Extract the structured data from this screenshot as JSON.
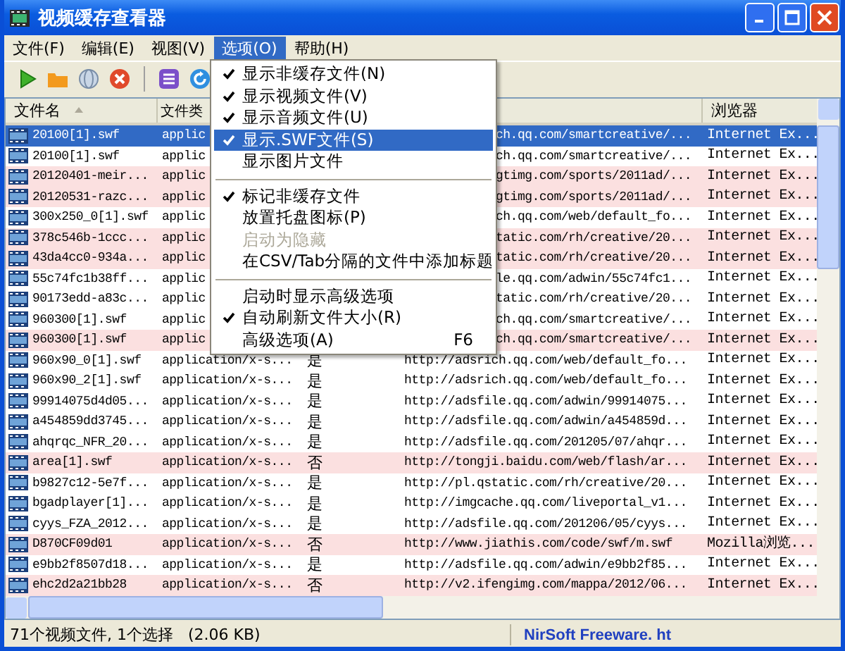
{
  "window": {
    "title": "视频缓存查看器"
  },
  "menu_bar": [
    {
      "label": "文件(F)",
      "selected": false
    },
    {
      "label": "编辑(E)",
      "selected": false
    },
    {
      "label": "视图(V)",
      "selected": false
    },
    {
      "label": "选项(O)",
      "selected": true
    },
    {
      "label": "帮助(H)",
      "selected": false
    }
  ],
  "options_menu": [
    {
      "kind": "item",
      "label": "显示非缓存文件(N)",
      "checked": true,
      "disabled": false,
      "selected": false
    },
    {
      "kind": "item",
      "label": "显示视频文件(V)",
      "checked": true,
      "disabled": false,
      "selected": false
    },
    {
      "kind": "item",
      "label": "显示音频文件(U)",
      "checked": true,
      "disabled": false,
      "selected": false
    },
    {
      "kind": "item",
      "label": "显示.SWF文件(S)",
      "checked": true,
      "disabled": false,
      "selected": true
    },
    {
      "kind": "item",
      "label": "显示图片文件",
      "checked": false,
      "disabled": false,
      "selected": false
    },
    {
      "kind": "separator"
    },
    {
      "kind": "item",
      "label": "标记非缓存文件",
      "checked": true,
      "disabled": false,
      "selected": false
    },
    {
      "kind": "item",
      "label": "放置托盘图标(P)",
      "checked": false,
      "disabled": false,
      "selected": false
    },
    {
      "kind": "item",
      "label": "启动为隐藏",
      "checked": false,
      "disabled": true,
      "selected": false
    },
    {
      "kind": "item",
      "label": "在CSV/Tab分隔的文件中添加标题",
      "checked": false,
      "disabled": false,
      "selected": false
    },
    {
      "kind": "separator"
    },
    {
      "kind": "item",
      "label": "启动时显示高级选项",
      "checked": false,
      "disabled": false,
      "selected": false
    },
    {
      "kind": "item",
      "label": "自动刷新文件大小(R)",
      "checked": true,
      "disabled": false,
      "selected": false
    },
    {
      "kind": "item",
      "label": "高级选项(A)",
      "shortcut": "F6",
      "checked": false,
      "disabled": false,
      "selected": false
    }
  ],
  "table": {
    "columns": [
      "文件名",
      "文件类",
      "浏览器"
    ],
    "rows": [
      {
        "kind": "covered",
        "name": "20100[1].swf",
        "type": "applic",
        "url": "ch.qq.com/smartcreative/...",
        "browser": "Internet Ex...",
        "marked": false,
        "selected": true
      },
      {
        "kind": "covered",
        "name": "20100[1].swf",
        "type": "applic",
        "url": "ch.qq.com/smartcreative/...",
        "browser": "Internet Ex...",
        "marked": false,
        "selected": false
      },
      {
        "kind": "covered",
        "name": "20120401-meir...",
        "type": "applic",
        "url": "gtimg.com/sports/2011ad/...",
        "browser": "Internet Ex...",
        "marked": true,
        "selected": false
      },
      {
        "kind": "covered",
        "name": "20120531-razc...",
        "type": "applic",
        "url": "gtimg.com/sports/2011ad/...",
        "browser": "Internet Ex...",
        "marked": true,
        "selected": false
      },
      {
        "kind": "covered",
        "name": "300x250_0[1].swf",
        "type": "applic",
        "url": "ch.qq.com/web/default_fo...",
        "browser": "Internet Ex...",
        "marked": false,
        "selected": false
      },
      {
        "kind": "covered",
        "name": "378c546b-1ccc...",
        "type": "applic",
        "url": "tatic.com/rh/creative/20...",
        "browser": "Internet Ex...",
        "marked": true,
        "selected": false
      },
      {
        "kind": "covered",
        "name": "43da4cc0-934a...",
        "type": "applic",
        "url": "tatic.com/rh/creative/20...",
        "browser": "Internet Ex...",
        "marked": true,
        "selected": false
      },
      {
        "kind": "covered",
        "name": "55c74fc1b38ff...",
        "type": "applic",
        "url": "le.qq.com/adwin/55c74fc1...",
        "browser": "Internet Ex...",
        "marked": false,
        "selected": false
      },
      {
        "kind": "covered",
        "name": "90173edd-a83c...",
        "type": "applic",
        "url": "tatic.com/rh/creative/20...",
        "browser": "Internet Ex...",
        "marked": false,
        "selected": false
      },
      {
        "kind": "covered",
        "name": "960300[1].swf",
        "type": "applic",
        "url": "ch.qq.com/smartcreative/...",
        "browser": "Internet Ex...",
        "marked": false,
        "selected": false
      },
      {
        "kind": "covered",
        "name": "960300[1].swf",
        "type": "applic",
        "url": "ch.qq.com/smartcreative/...",
        "browser": "Internet Ex...",
        "marked": true,
        "selected": false
      },
      {
        "kind": "full",
        "name": "960x90_0[1].swf",
        "type": "application/x-s...",
        "flag": "是",
        "url": "http://adsrich.qq.com/web/default_fo...",
        "browser": "Internet Ex...",
        "marked": false,
        "selected": false
      },
      {
        "kind": "full",
        "name": "960x90_2[1].swf",
        "type": "application/x-s...",
        "flag": "是",
        "url": "http://adsrich.qq.com/web/default_fo...",
        "browser": "Internet Ex...",
        "marked": false,
        "selected": false
      },
      {
        "kind": "full",
        "name": "99914075d4d05...",
        "type": "application/x-s...",
        "flag": "是",
        "url": "http://adsfile.qq.com/adwin/99914075...",
        "browser": "Internet Ex...",
        "marked": false,
        "selected": false
      },
      {
        "kind": "full",
        "name": "a454859dd3745...",
        "type": "application/x-s...",
        "flag": "是",
        "url": "http://adsfile.qq.com/adwin/a454859d...",
        "browser": "Internet Ex...",
        "marked": false,
        "selected": false
      },
      {
        "kind": "full",
        "name": "ahqrqc_NFR_20...",
        "type": "application/x-s...",
        "flag": "是",
        "url": "http://adsfile.qq.com/201205/07/ahqr...",
        "browser": "Internet Ex...",
        "marked": false,
        "selected": false
      },
      {
        "kind": "full",
        "name": "area[1].swf",
        "type": "application/x-s...",
        "flag": "否",
        "url": "http://tongji.baidu.com/web/flash/ar...",
        "browser": "Internet Ex...",
        "marked": true,
        "selected": false
      },
      {
        "kind": "full",
        "name": "b9827c12-5e7f...",
        "type": "application/x-s...",
        "flag": "是",
        "url": "http://pl.qstatic.com/rh/creative/20...",
        "browser": "Internet Ex...",
        "marked": false,
        "selected": false
      },
      {
        "kind": "full",
        "name": "bgadplayer[1]...",
        "type": "application/x-s...",
        "flag": "是",
        "url": "http://imgcache.qq.com/liveportal_v1...",
        "browser": "Internet Ex...",
        "marked": false,
        "selected": false
      },
      {
        "kind": "full",
        "name": "cyys_FZA_2012...",
        "type": "application/x-s...",
        "flag": "是",
        "url": "http://adsfile.qq.com/201206/05/cyys...",
        "browser": "Internet Ex...",
        "marked": false,
        "selected": false
      },
      {
        "kind": "full",
        "name": "D870CF09d01",
        "type": "application/x-s...",
        "flag": "否",
        "url": "http://www.jiathis.com/code/swf/m.swf",
        "browser": "Mozilla浏览...",
        "marked": true,
        "selected": false
      },
      {
        "kind": "full",
        "name": "e9bb2f8507d18...",
        "type": "application/x-s...",
        "flag": "是",
        "url": "http://adsfile.qq.com/adwin/e9bb2f85...",
        "browser": "Internet Ex...",
        "marked": false,
        "selected": false
      },
      {
        "kind": "full",
        "name": "ehc2d2a21bb28",
        "type": "application/x-s...",
        "flag": "否",
        "url": "http://v2.ifengimg.com/mappa/2012/06...",
        "browser": "Internet Ex...",
        "marked": true,
        "selected": false
      }
    ]
  },
  "status_bar": {
    "summary": "71个视频文件, 1个选择   (2.06 KB)",
    "credit": "NirSoft Freeware. ht"
  }
}
